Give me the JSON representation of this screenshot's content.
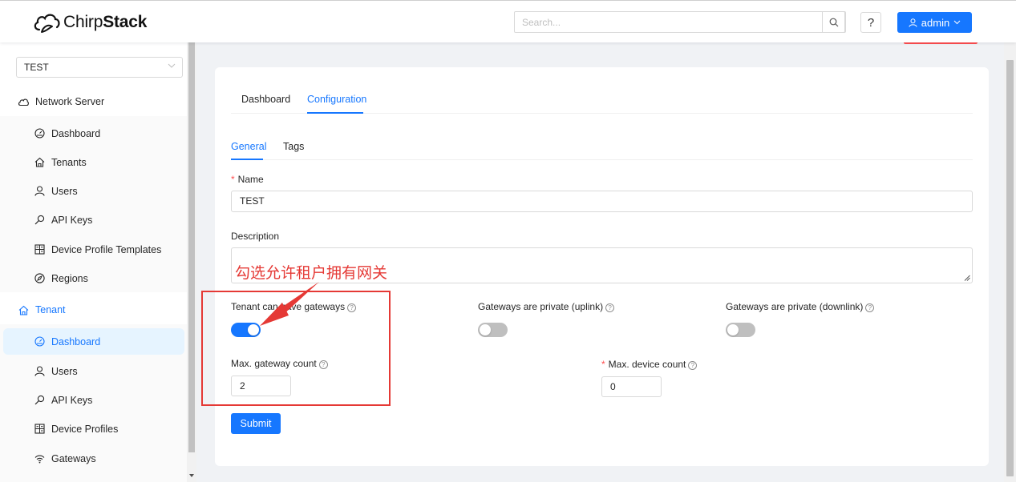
{
  "app": {
    "brand_light": "Chirp",
    "brand_bold": "Stack"
  },
  "header": {
    "search_placeholder": "Search...",
    "help_label": "?",
    "user_label": "admin"
  },
  "sidebar": {
    "tenant_selected": "TEST",
    "network_server": {
      "label": "Network Server",
      "items": [
        "Dashboard",
        "Tenants",
        "Users",
        "API Keys",
        "Device Profile Templates",
        "Regions"
      ]
    },
    "tenant": {
      "label": "Tenant",
      "items": [
        "Dashboard",
        "Users",
        "API Keys",
        "Device Profiles",
        "Gateways"
      ]
    }
  },
  "content": {
    "tabs": [
      "Dashboard",
      "Configuration"
    ],
    "active_tab": "Configuration",
    "subtabs": [
      "General",
      "Tags"
    ],
    "active_subtab": "General",
    "form": {
      "name_label": "Name",
      "name_value": "TEST",
      "description_label": "Description",
      "description_value": "",
      "can_have_gateways_label": "Tenant can have gateways",
      "can_have_gateways": true,
      "private_uplink_label": "Gateways are private (uplink)",
      "private_uplink": false,
      "private_downlink_label": "Gateways are private (downlink)",
      "private_downlink": false,
      "max_gateway_label": "Max. gateway count",
      "max_gateway_value": "2",
      "max_device_label": "Max. device count",
      "max_device_value": "0",
      "submit_label": "Submit"
    }
  },
  "annotation": {
    "text": "勾选允许租户拥有网关",
    "color": "#e53935"
  },
  "colors": {
    "primary": "#1677ff",
    "danger": "#ff4d4f"
  }
}
